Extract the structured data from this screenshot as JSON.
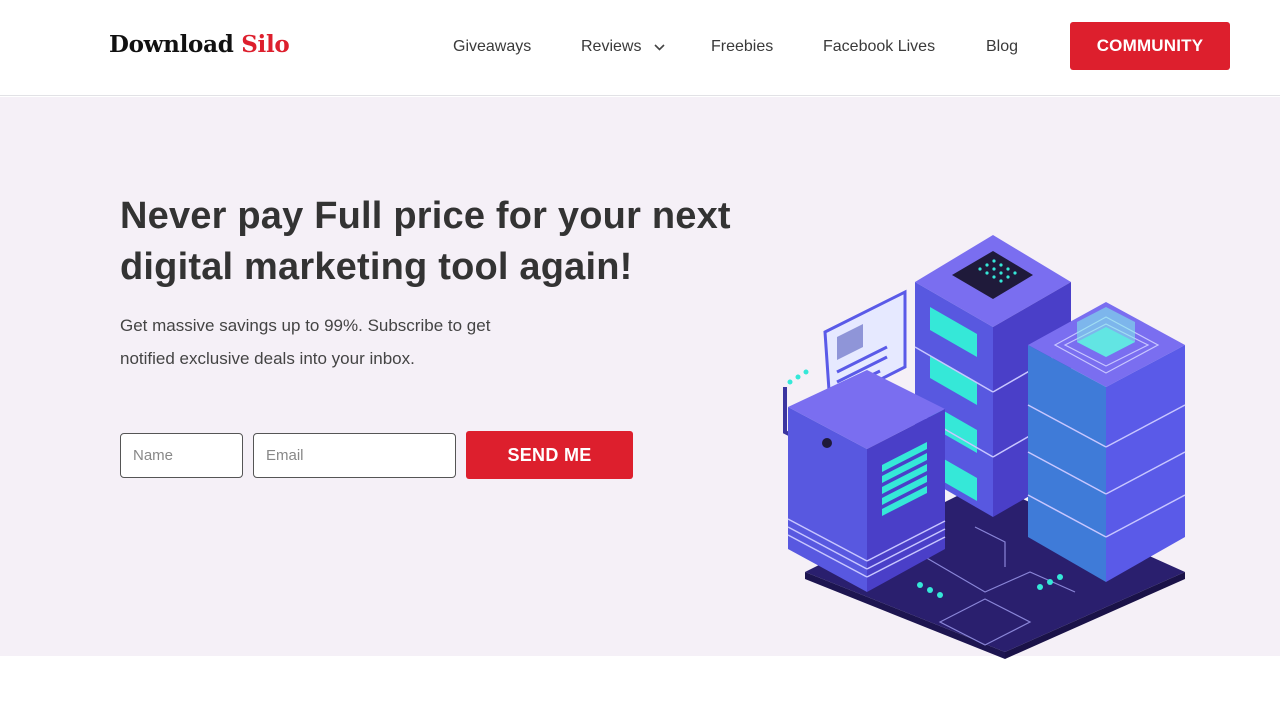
{
  "header": {
    "logo_main": "Download",
    "logo_accent": "Silo",
    "nav": {
      "giveaways": "Giveaways",
      "reviews": "Reviews",
      "freebies": "Freebies",
      "facebook_lives": "Facebook Lives",
      "blog": "Blog"
    },
    "community_label": "COMMUNITY"
  },
  "hero": {
    "title": "Never pay Full price for your next digital marketing tool again!",
    "subtitle": "Get massive savings up to 99%. Subscribe to get notified exclusive deals into your inbox.",
    "form": {
      "name_placeholder": "Name",
      "email_placeholder": "Email",
      "submit_label": "SEND ME"
    },
    "illustration": "isometric-servers-illustration"
  },
  "colors": {
    "accent": "#dd1f2d",
    "hero_background": "#f5f0f7",
    "server_blue": "#5a5ae8",
    "server_glow": "#35e8d8",
    "board_dark": "#2a1f6e"
  }
}
